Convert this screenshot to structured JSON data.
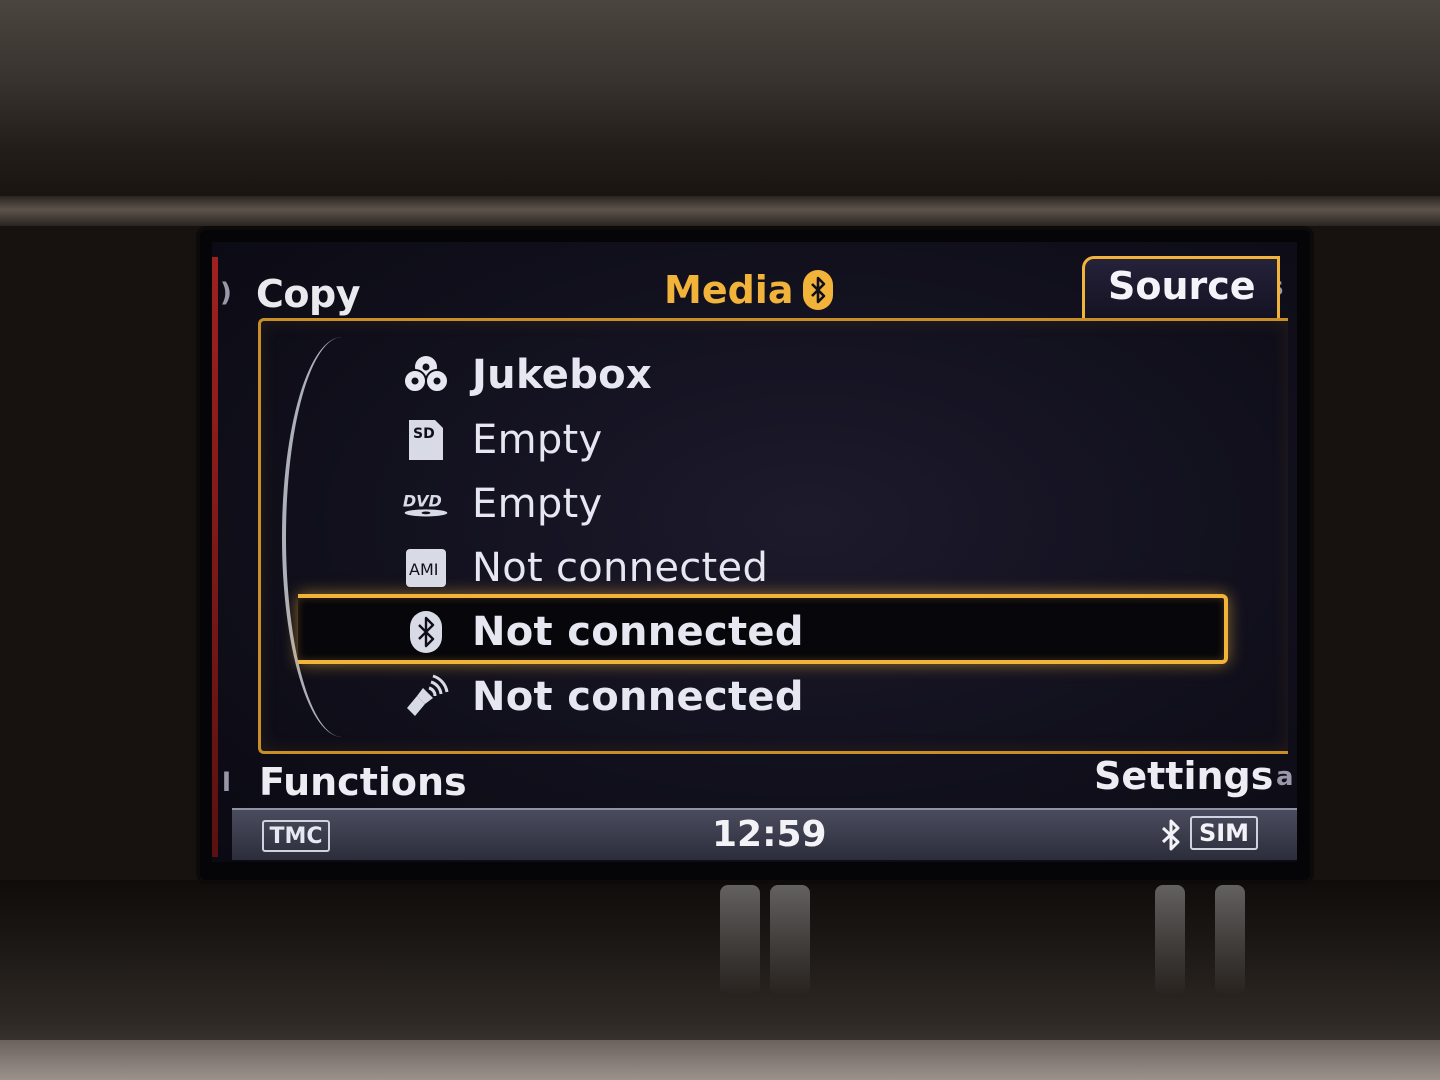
{
  "header": {
    "left_label": "Copy",
    "title": "Media",
    "title_icon": "bluetooth-icon",
    "active_tab": "Source"
  },
  "sources": [
    {
      "icon": "jukebox-icon",
      "label": "Jukebox",
      "selected": false
    },
    {
      "icon": "sd-card-icon",
      "label": "Empty",
      "selected": false
    },
    {
      "icon": "dvd-icon",
      "label": "Empty",
      "selected": false
    },
    {
      "icon": "ami-icon",
      "label": "Not connected",
      "selected": false
    },
    {
      "icon": "bluetooth-icon",
      "label": "Not connected",
      "selected": true
    },
    {
      "icon": "aux-audio-icon",
      "label": "Not connected",
      "selected": false
    }
  ],
  "footer": {
    "left_label": "Functions",
    "right_label": "Settings"
  },
  "status_bar": {
    "tmc_label": "TMC",
    "time": "12:59",
    "sim_label": "SIM",
    "bt_icon": "bluetooth-icon"
  },
  "colors": {
    "accent": "#f2b33a",
    "text": "#e6e7f0",
    "screen_bg": "#100f1b"
  }
}
